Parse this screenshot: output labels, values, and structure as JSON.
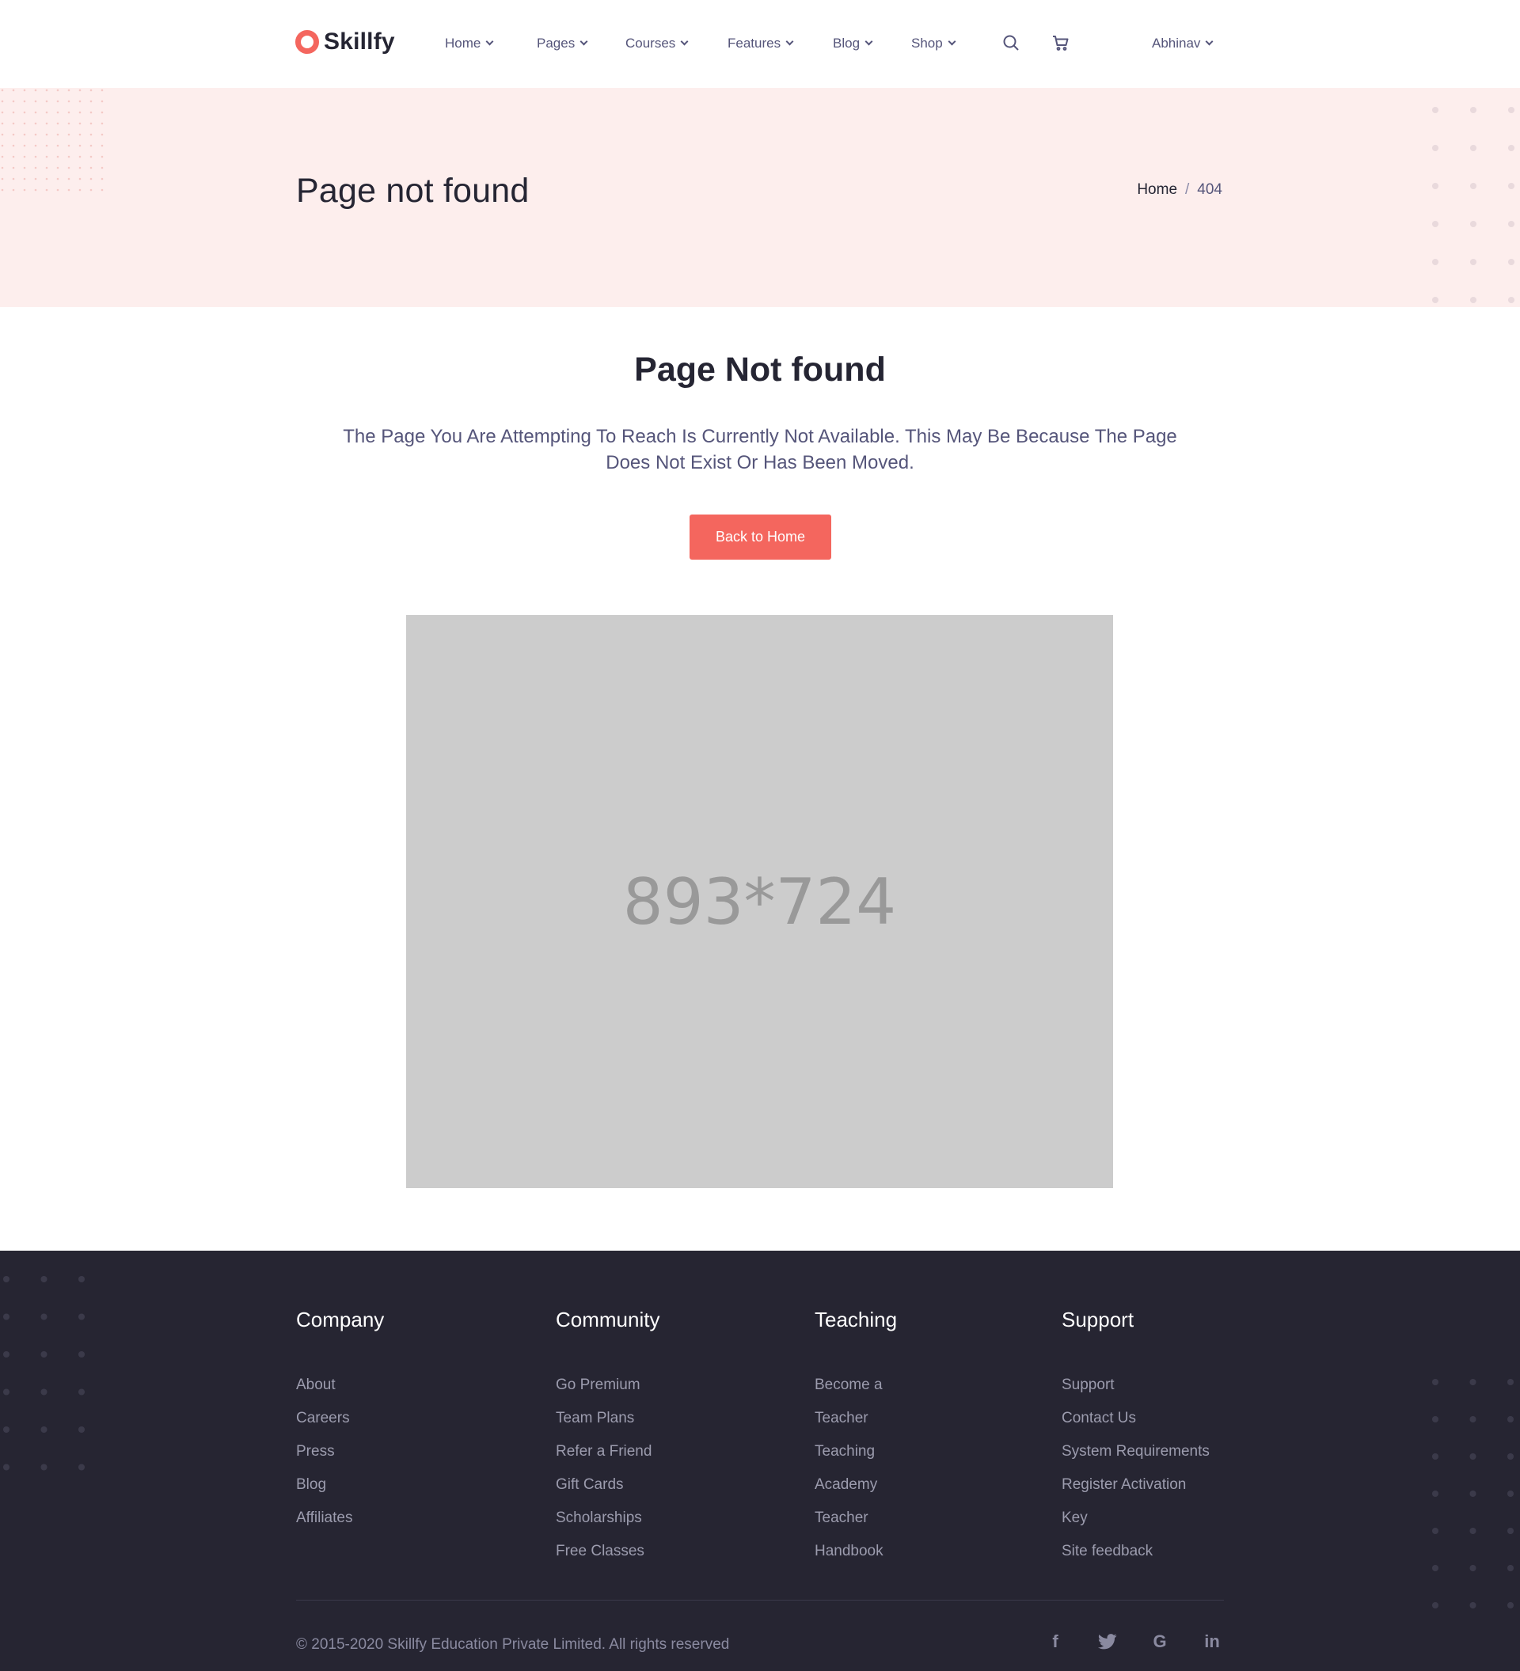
{
  "brand": {
    "name": "Skillfy",
    "accent": "#f4665e",
    "dark": "#262532",
    "band_bg": "#fdeeed"
  },
  "nav": {
    "items": [
      {
        "label": "Home"
      },
      {
        "label": "Pages"
      },
      {
        "label": "Courses"
      },
      {
        "label": "Features"
      },
      {
        "label": "Blog"
      },
      {
        "label": "Shop"
      }
    ],
    "search_icon": "search-icon",
    "cart_icon": "cart-icon",
    "user": "Abhinav"
  },
  "page_header": {
    "title": "Page not found",
    "breadcrumb": {
      "home": "Home",
      "separator": "/",
      "current": "404"
    }
  },
  "main": {
    "title": "Page Not found",
    "text": "The Page You Are Attempting To Reach Is Currently Not Available. This May Be Because The Page Does Not Exist Or Has Been Moved.",
    "button": "Back to Home",
    "image_placeholder": "893*724"
  },
  "footer": {
    "columns": [
      {
        "heading": "Company",
        "links": [
          "About",
          "Careers",
          "Press",
          "Blog",
          "Affiliates"
        ]
      },
      {
        "heading": "Community",
        "links": [
          "Go Premium",
          "Team Plans",
          "Refer a Friend",
          "Gift Cards",
          "Scholarships",
          "Free Classes"
        ]
      },
      {
        "heading": "Teaching",
        "links": [
          "Become a",
          "Teacher",
          "Teaching",
          "Academy",
          "Teacher",
          "Handbook"
        ]
      },
      {
        "heading": "Support",
        "links": [
          "Support",
          "Contact Us",
          "System Requirements",
          "Register Activation",
          "Key",
          "Site feedback"
        ]
      }
    ],
    "copyright": "© 2015-2020 Skillfy Education Private Limited. All rights reserved",
    "social": [
      {
        "icon": "facebook-icon",
        "glyph": "f"
      },
      {
        "icon": "twitter-icon",
        "glyph": ""
      },
      {
        "icon": "google-icon",
        "glyph": "G"
      },
      {
        "icon": "linkedin-icon",
        "glyph": "in"
      }
    ]
  }
}
